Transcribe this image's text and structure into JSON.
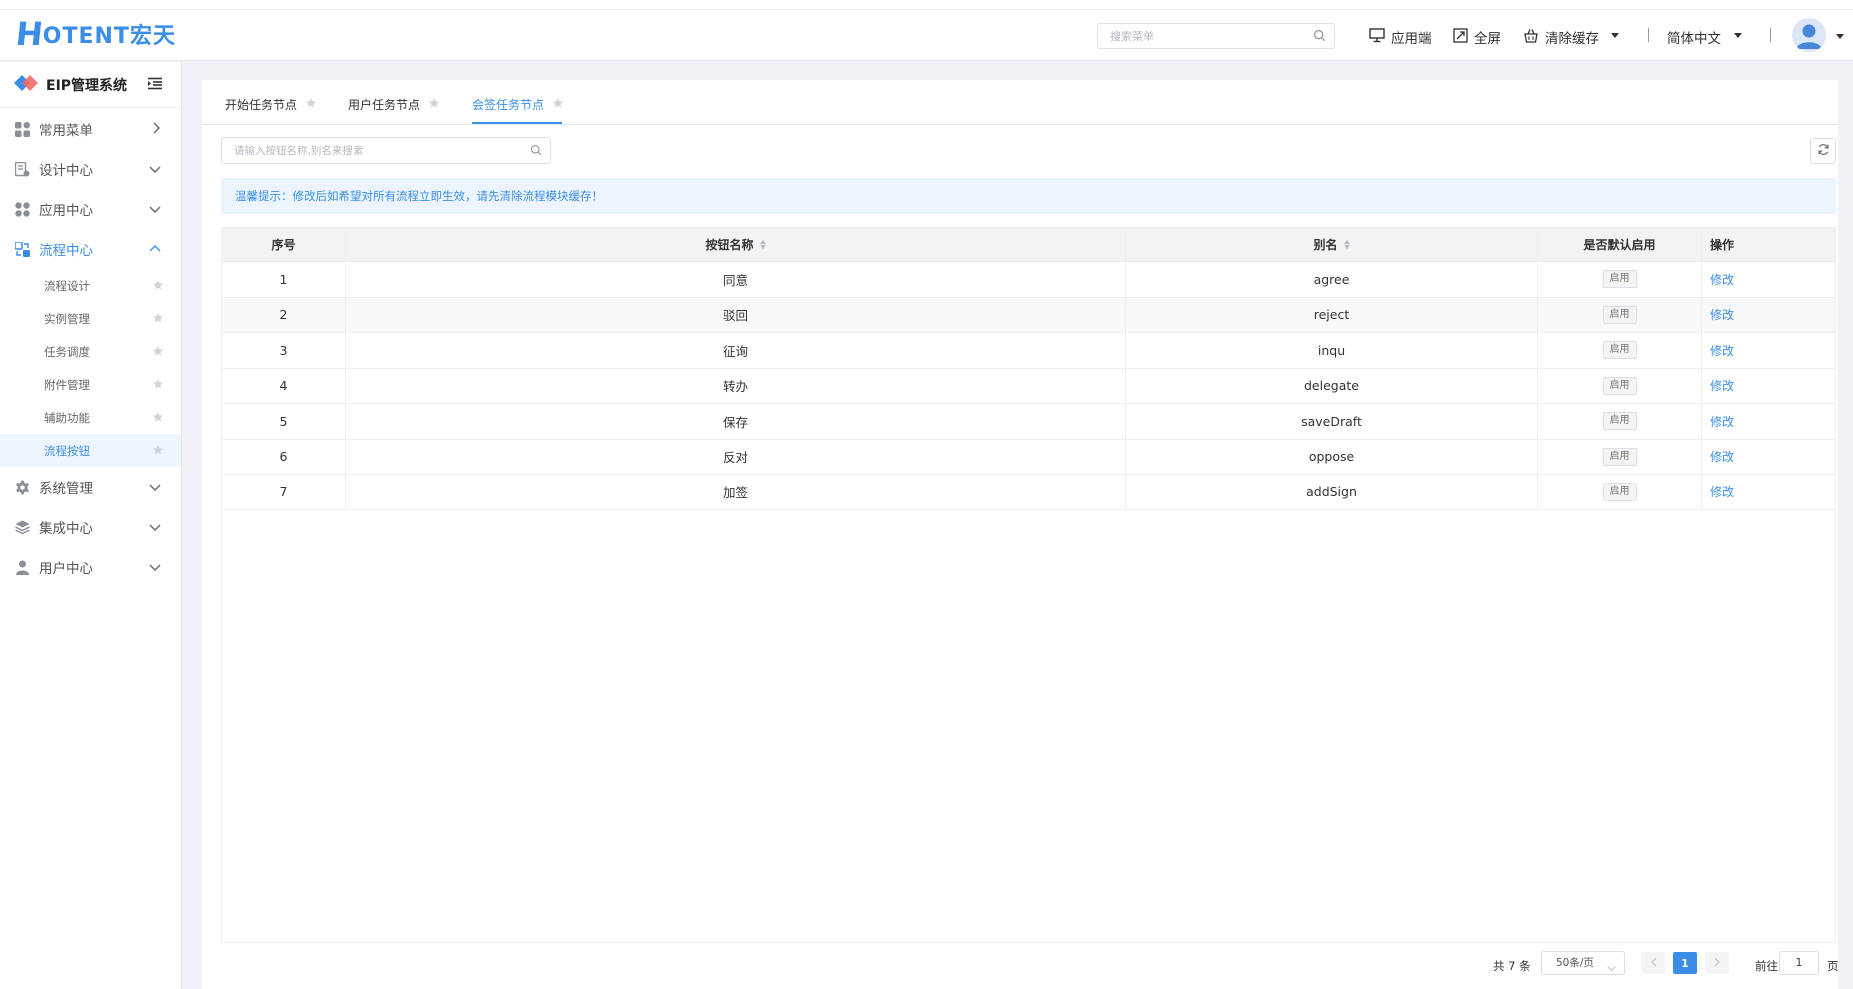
{
  "header": {
    "logo_h": "H",
    "logo_rest": "OTENT宏天",
    "search_placeholder": "搜索菜单",
    "app_label": "应用端",
    "fullscreen_label": "全屏",
    "clear_cache_label": "清除缓存",
    "language_label": "简体中文"
  },
  "sidebar": {
    "brand": "EIP管理系统",
    "menu": [
      {
        "label": "常用菜单"
      },
      {
        "label": "设计中心"
      },
      {
        "label": "应用中心"
      },
      {
        "label": "流程中心"
      },
      {
        "label": "系统管理"
      },
      {
        "label": "集成中心"
      },
      {
        "label": "用户中心"
      }
    ],
    "submenu": [
      {
        "label": "流程设计"
      },
      {
        "label": "实例管理"
      },
      {
        "label": "任务调度"
      },
      {
        "label": "附件管理"
      },
      {
        "label": "辅助功能"
      },
      {
        "label": "流程按钮"
      }
    ]
  },
  "tabs": [
    {
      "label": "开始任务节点"
    },
    {
      "label": "用户任务节点"
    },
    {
      "label": "会签任务节点"
    }
  ],
  "search": {
    "placeholder": "请输入按钮名称,别名来搜索"
  },
  "tip": "温馨提示：修改后如希望对所有流程立即生效，请先清除流程模块缓存！",
  "table": {
    "headers": [
      "序号",
      "按钮名称",
      "别名",
      "是否默认启用",
      "操作"
    ],
    "rows": [
      {
        "no": "1",
        "name": "同意",
        "alias": "agree",
        "status": "启用",
        "action": "修改"
      },
      {
        "no": "2",
        "name": "驳回",
        "alias": "reject",
        "status": "启用",
        "action": "修改"
      },
      {
        "no": "3",
        "name": "征询",
        "alias": "inqu",
        "status": "启用",
        "action": "修改"
      },
      {
        "no": "4",
        "name": "转办",
        "alias": "delegate",
        "status": "启用",
        "action": "修改"
      },
      {
        "no": "5",
        "name": "保存",
        "alias": "saveDraft",
        "status": "启用",
        "action": "修改"
      },
      {
        "no": "6",
        "name": "反对",
        "alias": "oppose",
        "status": "启用",
        "action": "修改"
      },
      {
        "no": "7",
        "name": "加签",
        "alias": "addSign",
        "status": "启用",
        "action": "修改"
      }
    ]
  },
  "pagination": {
    "total": "共 7 条",
    "page_size": "50条/页",
    "current_page": "1",
    "goto_label": "前往",
    "goto_value": "1",
    "page_suffix": "页"
  },
  "colors": {
    "accent": "#3b8ee8",
    "tip_bg": "#ecf5ff"
  },
  "icons": [
    "search-icon",
    "monitor-icon",
    "fullscreen-icon",
    "basket-icon",
    "refresh-icon",
    "star-icon",
    "chevron-down-icon",
    "chevron-right-icon",
    "chevron-up-icon",
    "menu-fold-icon",
    "user-avatar"
  ]
}
